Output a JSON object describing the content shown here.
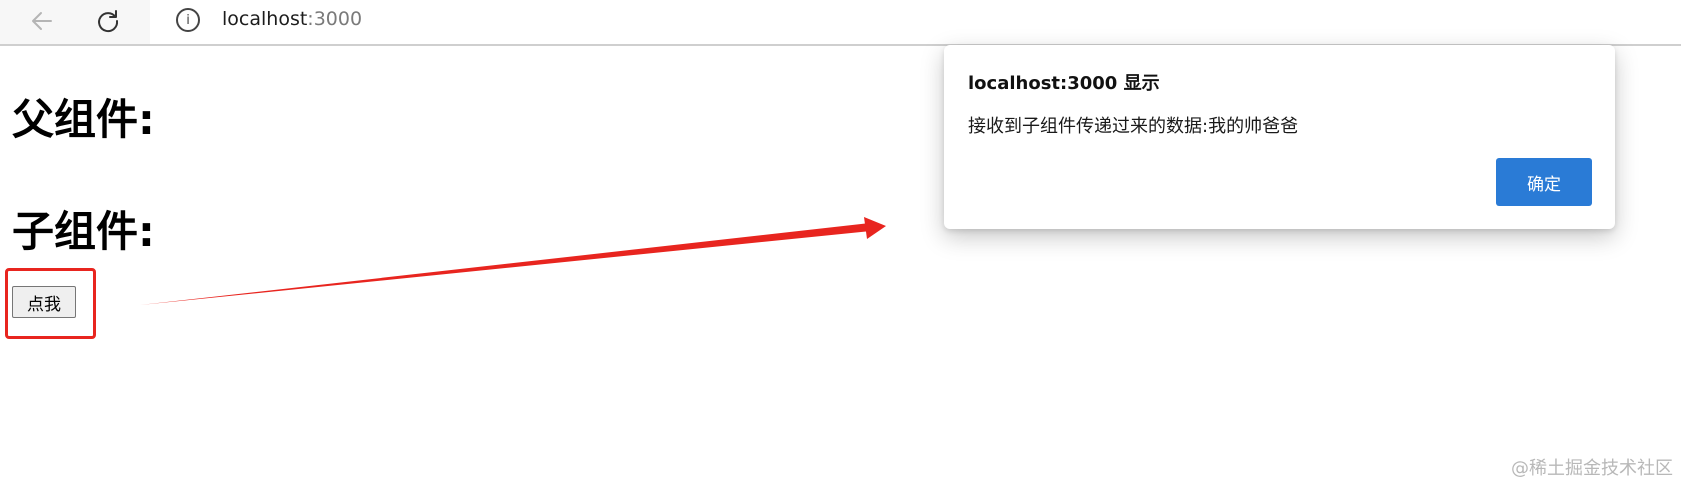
{
  "browser": {
    "url_host": "localhost",
    "url_port": ":3000",
    "icons": {
      "back": "back-arrow-icon",
      "reload": "reload-icon",
      "info": "info-icon"
    }
  },
  "page": {
    "parent_heading": "父组件:",
    "child_heading": "子组件:",
    "button_label": "点我"
  },
  "dialog": {
    "title": "localhost:3000 显示",
    "message": "接收到子组件传递过来的数据:我的帅爸爸",
    "ok_label": "确定"
  },
  "annotations": {
    "color": "#e8251f"
  },
  "watermark": "@稀土掘金技术社区"
}
